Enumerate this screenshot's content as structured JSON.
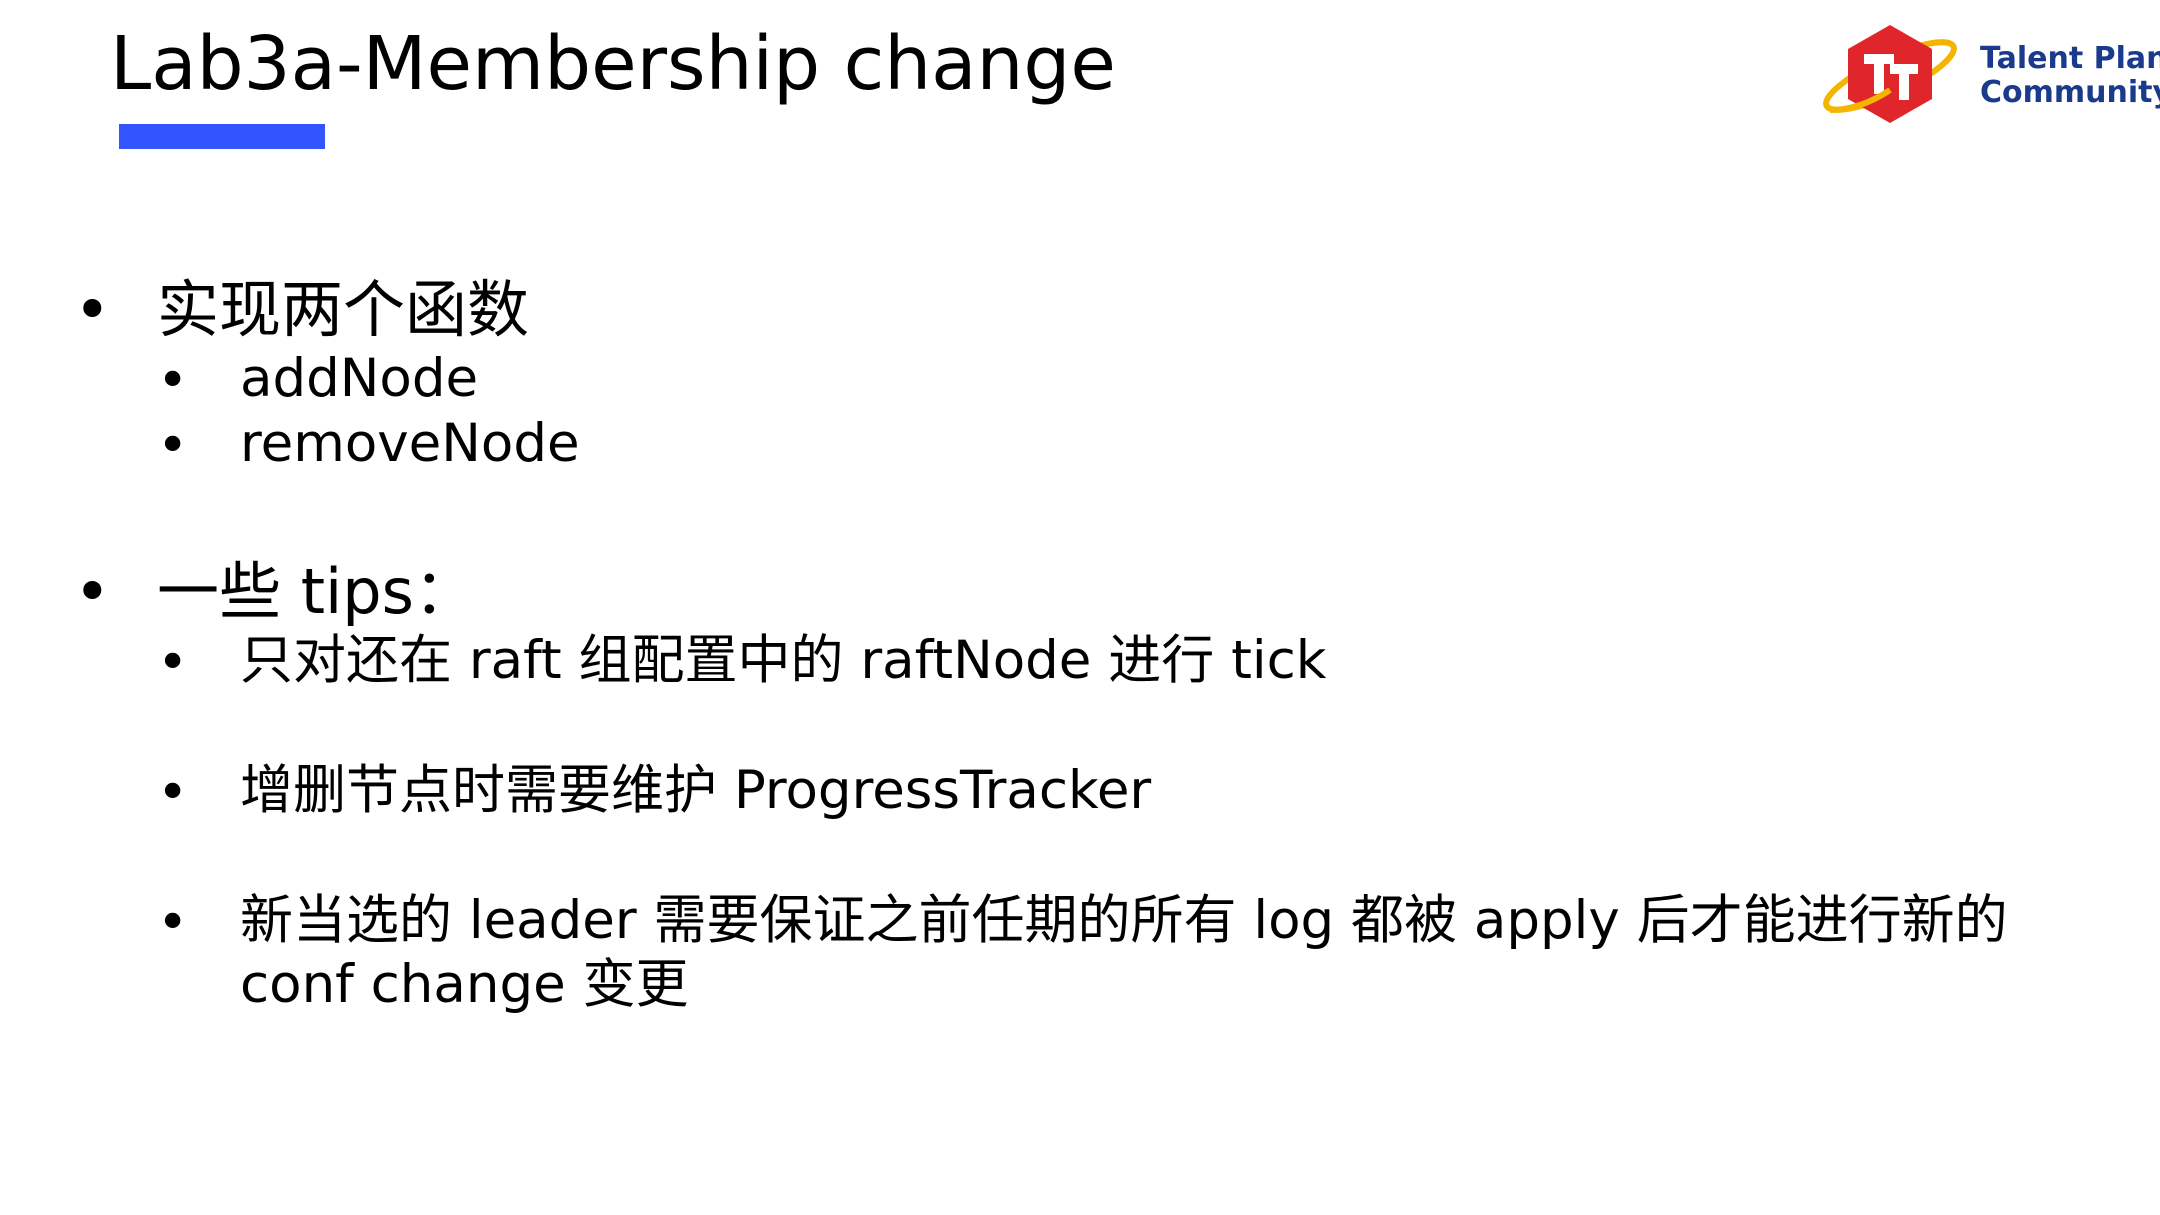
{
  "slide": {
    "title": "Lab3a-Membership change",
    "accent_color": "#3355ff"
  },
  "logo": {
    "line1": "Talent Plan",
    "line2": "Community",
    "text_color": "#1a3a8c",
    "hex_color": "#e0252b",
    "ring_color": "#f5b400"
  },
  "bullet_glyph": "•",
  "sections": [
    {
      "heading": "实现两个函数",
      "items": [
        "addNode",
        "removeNode"
      ]
    },
    {
      "heading": "一些 tips：",
      "items": [
        "只对还在 raft 组配置中的 raftNode 进行 tick",
        "增删节点时需要维护 ProgressTracker",
        "新当选的 leader 需要保证之前任期的所有 log 都被 apply 后才能进行新的",
        "conf change 变更"
      ]
    }
  ]
}
